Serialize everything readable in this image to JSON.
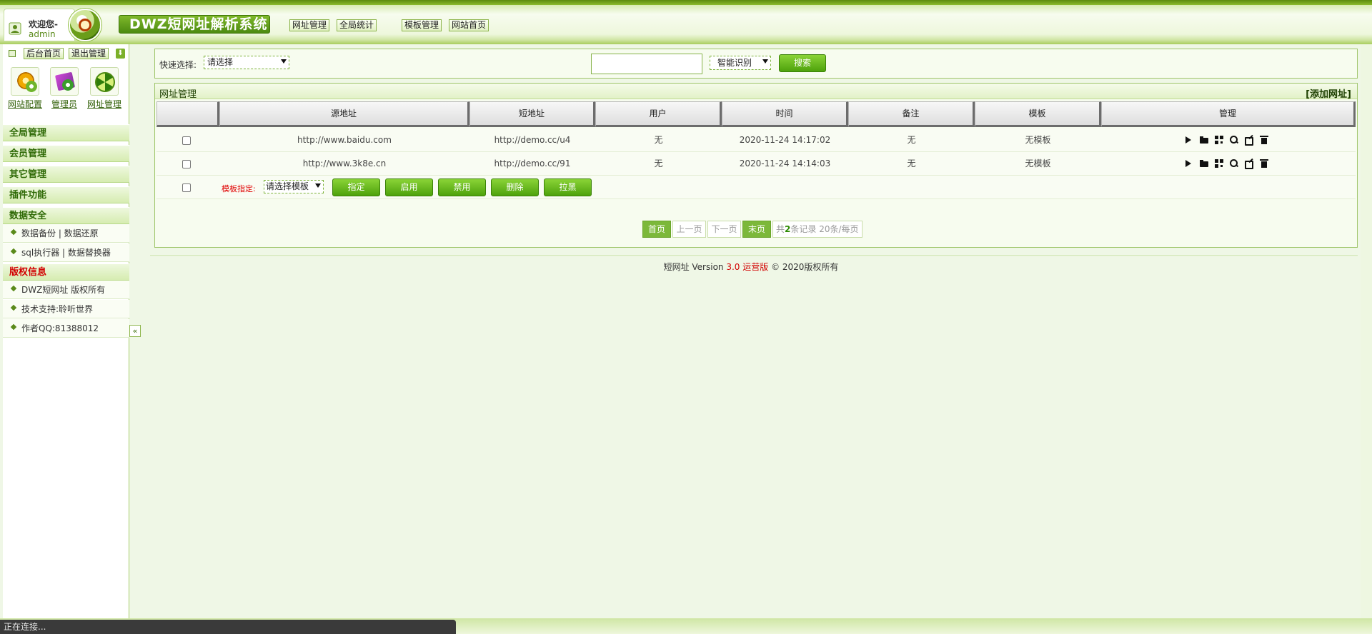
{
  "header": {
    "welcome": "欢迎您-",
    "username": "admin",
    "system_title": "DWZ短网址解析系统",
    "nav": [
      "网址管理",
      "全局统计",
      "模板管理",
      "网站首页"
    ]
  },
  "sidebar": {
    "toolbar": {
      "home_label": "后台首页",
      "logout_label": "退出管理"
    },
    "quick_links": [
      {
        "label": "网站配置",
        "icon": "gear-icon"
      },
      {
        "label": "管理员",
        "icon": "admin-book-icon"
      },
      {
        "label": "网址管理",
        "icon": "radiation-icon"
      }
    ],
    "menus": [
      {
        "title": "全局管理",
        "items": []
      },
      {
        "title": "会员管理",
        "items": []
      },
      {
        "title": "其它管理",
        "items": []
      },
      {
        "title": "插件功能",
        "items": []
      },
      {
        "title": "数据安全",
        "items": [
          "数据备份 | 数据还原",
          "sql执行器 | 数据替换器"
        ]
      },
      {
        "title": "版权信息",
        "items": [
          "DWZ短网址 版权所有",
          "技术支持:聆听世界",
          "作者QQ:81388012"
        ]
      }
    ],
    "collapse": "«"
  },
  "search": {
    "quick_select_label": "快速选择:",
    "quick_select_value": "请选择",
    "keyword_value": "",
    "mode_value": "智能识别",
    "search_label": "搜索"
  },
  "panel": {
    "title": "网址管理",
    "add_link": "[添加网址]"
  },
  "table": {
    "columns": [
      "",
      "源地址",
      "短地址",
      "用户",
      "时间",
      "备注",
      "模板",
      "管理"
    ],
    "rows": [
      {
        "source": "http://www.baidu.com",
        "short": "http://demo.cc/u4",
        "user": "无",
        "time": "2020-11-24 14:17:02",
        "note": "无",
        "template": "无模板"
      },
      {
        "source": "http://www.3k8e.cn",
        "short": "http://demo.cc/91",
        "user": "无",
        "time": "2020-11-24 14:14:03",
        "note": "无",
        "template": "无模板"
      }
    ],
    "row_icons": [
      "play-icon",
      "folder-open-icon",
      "qrcode-icon",
      "search-icon",
      "edit-icon",
      "trash-icon"
    ]
  },
  "batch": {
    "template_label": "模板指定:",
    "template_select": "请选择模板",
    "buttons": [
      "指定",
      "启用",
      "禁用",
      "删除",
      "拉黑"
    ]
  },
  "pager": {
    "first": "首页",
    "prev": "上一页",
    "next": "下一页",
    "last": "末页",
    "summary_prefix": "共",
    "summary_count": "2",
    "summary_suffix": "条记录 20条/每页"
  },
  "footer": {
    "prefix": "短网址 Version ",
    "version": "3.0 运营版",
    "suffix": " © 2020版权所有"
  },
  "status": {
    "text": "正在连接..."
  }
}
